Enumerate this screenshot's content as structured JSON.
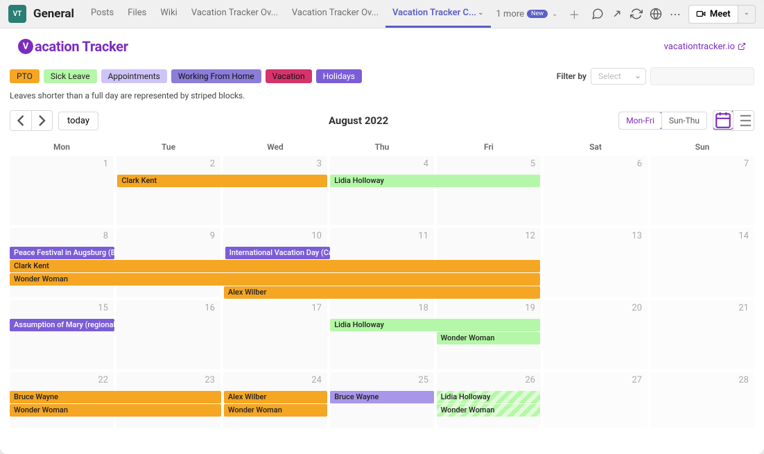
{
  "topbar": {
    "team_initials": "VT",
    "channel": "General",
    "tabs": [
      "Posts",
      "Files",
      "Wiki",
      "Vacation Tracker Ov...",
      "Vacation Tracker Ov...",
      "Vacation Tracker C..."
    ],
    "active_tab_index": 5,
    "more_label": "1 more",
    "new_label": "New",
    "meet_label": "Meet"
  },
  "app": {
    "title": "acation Tracker",
    "ext_link": "vacationtracker.io"
  },
  "legend": {
    "pto": "PTO",
    "sick": "Sick Leave",
    "appt": "Appointments",
    "wfh": "Working From Home",
    "vac": "Vacation",
    "hol": "Holidays",
    "filter_label": "Filter by",
    "select_placeholder": "Select"
  },
  "hint": "Leaves shorter than a full day are represented by striped blocks.",
  "toolbar": {
    "today": "today",
    "title": "August 2022",
    "monfri": "Mon-Fri",
    "sunthu": "Sun-Thu"
  },
  "dow": [
    "Mon",
    "Tue",
    "Wed",
    "Thu",
    "Fri",
    "Sat",
    "Sun"
  ],
  "weeks": [
    {
      "days": [
        "1",
        "2",
        "3",
        "4",
        "5",
        "6",
        "7"
      ]
    },
    {
      "days": [
        "8",
        "9",
        "10",
        "11",
        "12",
        "13",
        "14"
      ]
    },
    {
      "days": [
        "15",
        "16",
        "17",
        "18",
        "19",
        "20",
        "21"
      ]
    },
    {
      "days": [
        "22",
        "23",
        "24",
        "25",
        "26",
        "27",
        "28"
      ]
    }
  ],
  "events": {
    "w0": {
      "clark": "Clark Kent",
      "lidia": "Lidia Holloway"
    },
    "w1": {
      "peace": "Peace Festival in Augsburg (Bavaria)",
      "intl": "International Vacation Day (Canada)",
      "clark": "Clark Kent",
      "wonder": "Wonder Woman",
      "alex": "Alex Wilber"
    },
    "w2": {
      "assumption": "Assumption of Mary (regional holiday)",
      "lidia": "Lidia Holloway",
      "wonder": "Wonder Woman"
    },
    "w3": {
      "bruce": "Bruce Wayne",
      "wonder": "Wonder Woman",
      "alex": "Alex Wilber",
      "wonder2": "Wonder Woman",
      "bruce2": "Bruce Wayne",
      "lidia": "Lidia Holloway",
      "wonder3": "Wonder Woman"
    }
  }
}
